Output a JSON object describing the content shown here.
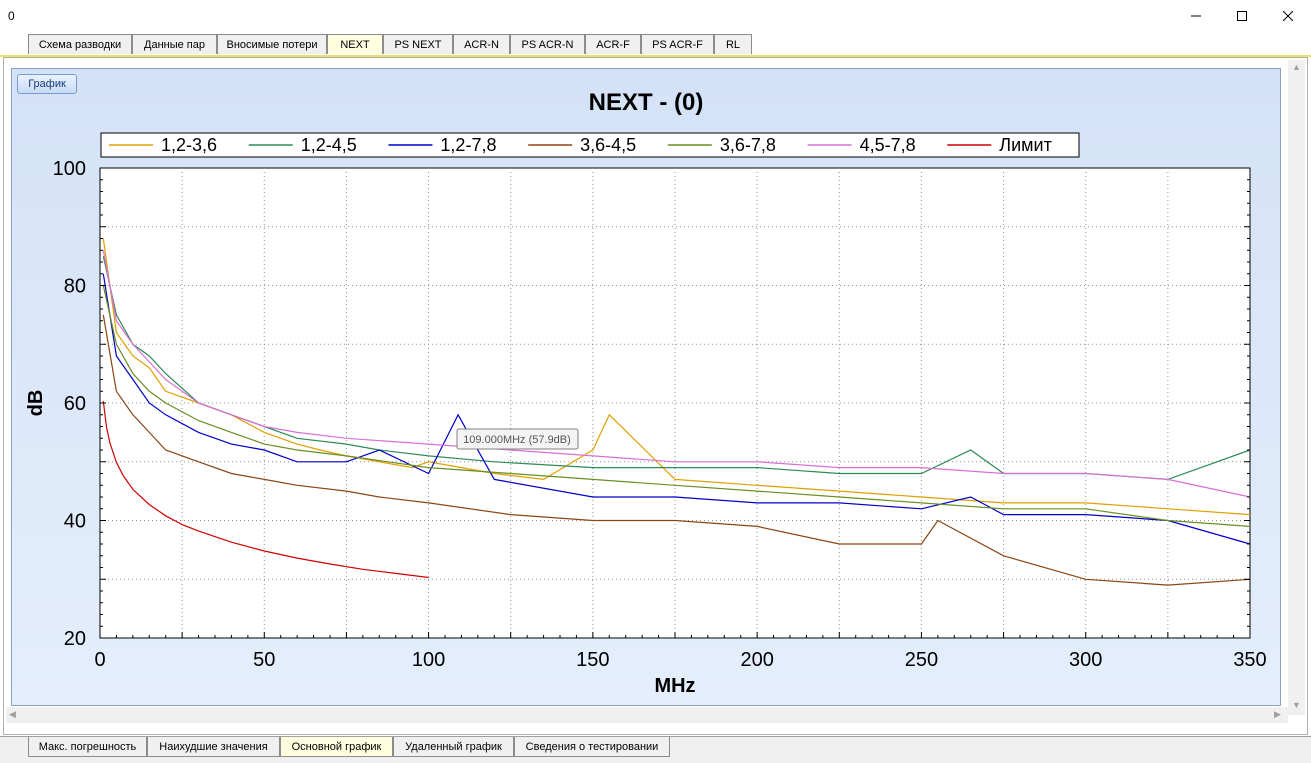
{
  "window": {
    "title": "0"
  },
  "tabs_top": [
    {
      "label": "Схема разводки",
      "active": false
    },
    {
      "label": "Данные пар",
      "active": false
    },
    {
      "label": "Вносимые потери",
      "active": false
    },
    {
      "label": "NEXT",
      "active": true
    },
    {
      "label": "PS NEXT",
      "active": false
    },
    {
      "label": "ACR-N",
      "active": false
    },
    {
      "label": "PS ACR-N",
      "active": false
    },
    {
      "label": "ACR-F",
      "active": false
    },
    {
      "label": "PS ACR-F",
      "active": false
    },
    {
      "label": "RL",
      "active": false
    }
  ],
  "tabs_bottom": [
    {
      "label": "Макс. погрешность",
      "active": false
    },
    {
      "label": "Наихудшие значения",
      "active": false
    },
    {
      "label": "Основной график",
      "active": true
    },
    {
      "label": "Удаленный график",
      "active": false
    },
    {
      "label": "Сведения о тестировании",
      "active": false
    }
  ],
  "graph_button": "График",
  "chart_data": {
    "type": "line",
    "title": "NEXT - (0)",
    "xlabel": "MHz",
    "ylabel": "dB",
    "xlim": [
      0,
      350
    ],
    "ylim": [
      20,
      100
    ],
    "xticks": [
      0,
      50,
      100,
      150,
      200,
      250,
      300,
      350
    ],
    "yticks": [
      20,
      40,
      60,
      80,
      100
    ],
    "grid": true,
    "legend_position": "top",
    "tooltip": {
      "text": "109.000MHz (57.9dB)",
      "x": 109.0,
      "y": 57.9
    },
    "series": [
      {
        "name": "1,2-3,6",
        "color": "#e0a000",
        "x": [
          1,
          5,
          10,
          15,
          20,
          30,
          40,
          50,
          60,
          67,
          75,
          85,
          95,
          100,
          110,
          120,
          135,
          150,
          155,
          175,
          200,
          225,
          250,
          275,
          300,
          325,
          350
        ],
        "y": [
          88,
          72,
          68,
          66,
          62,
          60,
          58,
          55,
          53,
          52,
          51,
          50,
          49,
          50,
          49,
          48,
          47,
          52,
          58,
          47,
          46,
          45,
          44,
          43,
          43,
          42,
          41
        ]
      },
      {
        "name": "1,2-4,5",
        "color": "#2e8b57",
        "x": [
          1,
          5,
          10,
          15,
          20,
          30,
          40,
          50,
          60,
          75,
          85,
          100,
          120,
          150,
          175,
          200,
          225,
          250,
          265,
          275,
          300,
          325,
          350
        ],
        "y": [
          85,
          75,
          70,
          68,
          65,
          60,
          58,
          56,
          54,
          53,
          52,
          51,
          50,
          49,
          49,
          49,
          48,
          48,
          52,
          48,
          48,
          47,
          52
        ]
      },
      {
        "name": "1,2-7,8",
        "color": "#0000c8",
        "x": [
          1,
          5,
          10,
          15,
          20,
          30,
          40,
          50,
          60,
          75,
          85,
          100,
          109,
          120,
          150,
          175,
          200,
          225,
          250,
          265,
          275,
          300,
          325,
          350
        ],
        "y": [
          82,
          68,
          64,
          60,
          58,
          55,
          53,
          52,
          50,
          50,
          52,
          48,
          58,
          47,
          44,
          44,
          43,
          43,
          42,
          44,
          41,
          41,
          40,
          36
        ]
      },
      {
        "name": "3,6-4,5",
        "color": "#8b4513",
        "x": [
          1,
          5,
          10,
          15,
          20,
          30,
          40,
          50,
          60,
          75,
          85,
          100,
          125,
          150,
          175,
          200,
          225,
          250,
          255,
          275,
          300,
          325,
          350
        ],
        "y": [
          75,
          62,
          58,
          55,
          52,
          50,
          48,
          47,
          46,
          45,
          44,
          43,
          41,
          40,
          40,
          39,
          36,
          36,
          40,
          34,
          30,
          29,
          30
        ]
      },
      {
        "name": "3,6-7,8",
        "color": "#6b8e23",
        "x": [
          1,
          5,
          10,
          15,
          20,
          30,
          40,
          50,
          60,
          75,
          100,
          125,
          150,
          175,
          200,
          225,
          250,
          275,
          300,
          325,
          350
        ],
        "y": [
          80,
          70,
          65,
          62,
          60,
          57,
          55,
          53,
          52,
          51,
          49,
          48,
          47,
          46,
          45,
          44,
          43,
          42,
          42,
          40,
          39
        ]
      },
      {
        "name": "4,5-7,8",
        "color": "#da70d6",
        "x": [
          1,
          5,
          10,
          15,
          20,
          30,
          40,
          50,
          60,
          75,
          100,
          125,
          150,
          175,
          200,
          225,
          250,
          275,
          300,
          325,
          350
        ],
        "y": [
          86,
          74,
          70,
          67,
          64,
          60,
          58,
          56,
          55,
          54,
          53,
          52,
          51,
          50,
          50,
          49,
          49,
          48,
          48,
          47,
          44
        ]
      },
      {
        "name": "Лимит",
        "color": "#cc0000",
        "x": [
          1,
          2,
          3,
          5,
          7,
          10,
          15,
          20,
          25,
          30,
          40,
          50,
          60,
          70,
          80,
          90,
          100
        ],
        "y": [
          60.3,
          55.8,
          53.2,
          49.9,
          47.7,
          45.3,
          42.7,
          40.8,
          39.3,
          38.2,
          36.3,
          34.8,
          33.6,
          32.6,
          31.7,
          31.0,
          30.3
        ]
      }
    ]
  }
}
